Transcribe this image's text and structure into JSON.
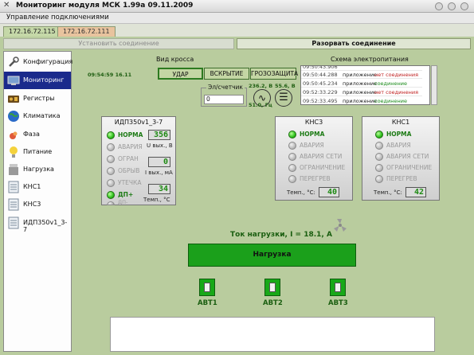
{
  "window": {
    "title": "Мониторинг модуля МСК 1.99а 09.11.2009"
  },
  "menu": {
    "connection": "Управление подключениями"
  },
  "tabs": [
    {
      "label": "172.16.72.115"
    },
    {
      "label": "172.16.72.111"
    }
  ],
  "toolbar": {
    "connect_label": "Установить соединение",
    "disconnect_label": "Разорвать соединение"
  },
  "sidebar": {
    "items": [
      {
        "label": "Конфигурация",
        "icon": "wrench-icon"
      },
      {
        "label": "Мониторинг",
        "icon": "monitor-icon"
      },
      {
        "label": "Регистры",
        "icon": "registers-icon"
      },
      {
        "label": "Климатика",
        "icon": "globe-icon"
      },
      {
        "label": "Фаза",
        "icon": "phase-icon"
      },
      {
        "label": "Питание",
        "icon": "bulb-icon"
      },
      {
        "label": "Нагрузка",
        "icon": "load-icon"
      },
      {
        "label": "КНС1",
        "icon": "document-icon"
      },
      {
        "label": "КНС3",
        "icon": "document-icon"
      },
      {
        "label": "ИДП350v1_3-7",
        "icon": "document-icon"
      }
    ]
  },
  "cross": {
    "title": "Вид кросса",
    "time": "09:54:59 16.11",
    "buttons": [
      {
        "label": "УДАР"
      },
      {
        "label": "ВСКРЫТИЕ"
      },
      {
        "label": "ГРОЗОЗАЩИТА"
      }
    ],
    "counter_label": "Эл/счетчик",
    "counter_value": "0",
    "voltage": "236.2, В",
    "frequency": "51.0, Гц",
    "dc_value": "55.6, В"
  },
  "power_scheme": {
    "title": "Схема электропитания",
    "log": [
      {
        "time": "09:50:44.288",
        "source": "приложение",
        "status": "нет соединения",
        "color": "#c02020"
      },
      {
        "time": "09:50:45.234",
        "source": "приложение",
        "status": "соединение",
        "color": "#1a8a1a"
      },
      {
        "time": "09:52:33.229",
        "source": "приложение",
        "status": "нет соединения",
        "color": "#c02020"
      },
      {
        "time": "09:52:33.495",
        "source": "приложение",
        "status": "соединение",
        "color": "#1a8a1a"
      }
    ]
  },
  "idp_panel": {
    "title": "ИДП350v1_3-7",
    "leds": [
      {
        "label": "НОРМА",
        "on": true
      },
      {
        "label": "АВАРИЯ",
        "on": false
      },
      {
        "label": "ОГРАН",
        "on": false
      },
      {
        "label": "ОБРЫВ",
        "on": false
      },
      {
        "label": "УТЕЧКА",
        "on": false
      },
      {
        "label": "ДП+",
        "on": true
      },
      {
        "label": "ДП-",
        "on": false
      }
    ],
    "u_out_value": "356",
    "u_out_label": "U вых., В",
    "i_out_value": "0",
    "i_out_label": "I вых., мА",
    "temp_value": "34",
    "temp_label": "Темп., °С"
  },
  "kns3_panel": {
    "title": "КНС3",
    "leds": [
      {
        "label": "НОРМА",
        "on": true
      },
      {
        "label": "АВАРИЯ",
        "on": false
      },
      {
        "label": "АВАРИЯ СЕТИ",
        "on": false
      },
      {
        "label": "ОГРАНИЧЕНИЕ",
        "on": false
      },
      {
        "label": "ПЕРЕГРЕВ",
        "on": false
      }
    ],
    "temp_label": "Темп., °С:",
    "temp_value": "40"
  },
  "kns1_panel": {
    "title": "КНС1",
    "leds": [
      {
        "label": "НОРМА",
        "on": true
      },
      {
        "label": "АВАРИЯ",
        "on": false
      },
      {
        "label": "АВАРИЯ СЕТИ",
        "on": false
      },
      {
        "label": "ОГРАНИЧЕНИЕ",
        "on": false
      },
      {
        "label": "ПЕРЕГРЕВ",
        "on": false
      }
    ],
    "temp_label": "Темп., °С:",
    "temp_value": "42"
  },
  "load": {
    "current_label": "Ток нагрузки, I = 18.1, А",
    "bar_label": "Нагрузка",
    "breakers": [
      {
        "label": "АВТ1"
      },
      {
        "label": "АВТ2"
      },
      {
        "label": "АВТ3"
      }
    ]
  },
  "colors": {
    "background": "#b9cc9e",
    "led_on": "#2ec11c",
    "load_bar": "#1ba01b",
    "selected": "#1a2a8c"
  }
}
